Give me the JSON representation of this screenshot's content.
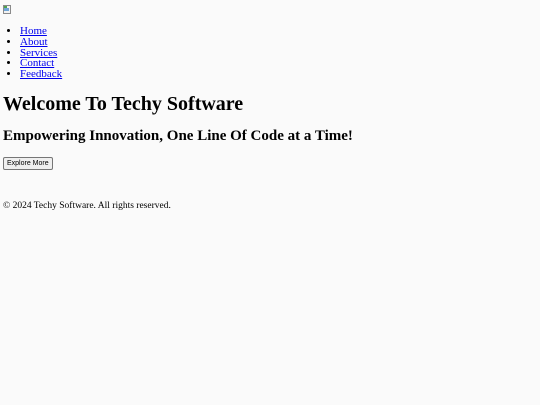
{
  "header": {
    "logo_icon": "broken-image-icon"
  },
  "nav": {
    "items": [
      {
        "label": "Home"
      },
      {
        "label": "About"
      },
      {
        "label": "Services"
      },
      {
        "label": "Contact"
      },
      {
        "label": "Feedback"
      }
    ],
    "link_color": "#0000ee"
  },
  "hero": {
    "title": "Welcome To Techy Software",
    "subtitle": "Empowering Innovation, One Line Of Code at a Time!",
    "button_label": "Explore More"
  },
  "footer": {
    "text": "© 2024 Techy Software. All rights reserved."
  },
  "colors": {
    "background": "#fafafa",
    "text": "#000000"
  }
}
